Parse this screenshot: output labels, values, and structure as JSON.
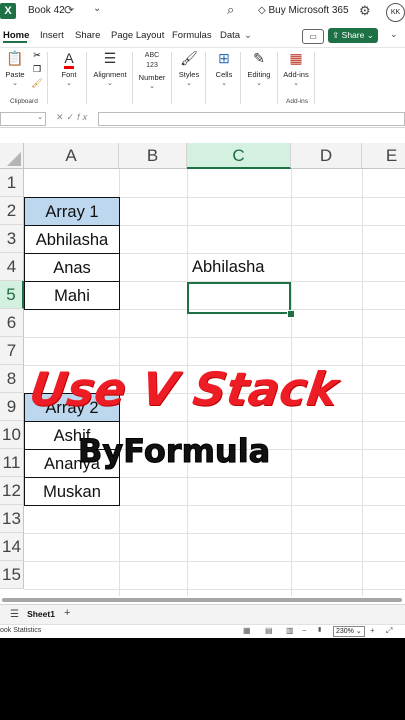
{
  "titlebar": {
    "file_name": "Book 42",
    "buy_label": "Buy Microsoft 365",
    "avatar_initials": "KK"
  },
  "tabs": [
    "Home",
    "Insert",
    "Share",
    "Page Layout",
    "Formulas",
    "Data"
  ],
  "share_label": "Share",
  "ribbon": {
    "paste": "Paste",
    "clipboard_group": "Clipboard",
    "font": "Font",
    "alignment": "Alignment",
    "number": "Number",
    "styles": "Styles",
    "cells": "Cells",
    "editing": "Editing",
    "addins": "Add-ins",
    "addins_group": "Add-ins"
  },
  "formula_bar": {
    "name_box": "",
    "fx": "fx",
    "value": ""
  },
  "grid": {
    "columns": [
      "A",
      "B",
      "C",
      "D",
      "E"
    ],
    "rows": [
      "1",
      "2",
      "3",
      "4",
      "5",
      "6",
      "7",
      "8",
      "9",
      "10",
      "11",
      "12",
      "13",
      "14",
      "15"
    ],
    "cells": {
      "A2": "Array 1",
      "A3": "Abhilasha",
      "A4": "Anas",
      "A5": "Mahi",
      "A9": "Array 2",
      "A10": "Ashif",
      "A11": "Ananya",
      "A12": "Muskan",
      "C4": "Abhilasha"
    },
    "selected_cell": "C5"
  },
  "overlay": {
    "headline": "Use V Stack",
    "subline": "ByFormula"
  },
  "sheet_tabs": [
    "Sheet1"
  ],
  "status": {
    "left": "ook Statistics",
    "zoom": "230%"
  },
  "colors": {
    "accent": "#1e7145",
    "header_fill": "#bdd7ee",
    "headline": "#ee1c24"
  }
}
